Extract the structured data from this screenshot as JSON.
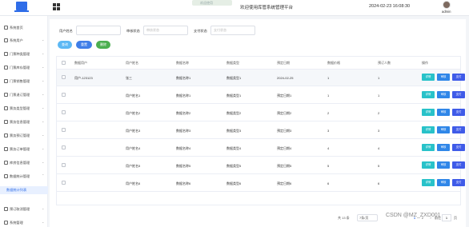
{
  "header": {
    "notice": "欢迎使用",
    "app_title": "欢迎使用库管系统管理平台",
    "datetime": "2024-02-23 16:08:30",
    "user": "admin"
  },
  "sidebar": {
    "items": [
      {
        "label": "系统首页"
      },
      {
        "label": "系统用户"
      },
      {
        "label": "门票种类管理"
      },
      {
        "label": "门票库存管理"
      },
      {
        "label": "门票销售管理"
      },
      {
        "label": "门票退订管理"
      },
      {
        "label": "票务类型管理"
      },
      {
        "label": "票务信息管理"
      },
      {
        "label": "票务预订管理"
      },
      {
        "label": "票务订单管理"
      },
      {
        "label": "库房信息管理"
      },
      {
        "label": "数据统计管理"
      },
      {
        "label": "数据统计列表"
      },
      {
        "label": "预订取消管理"
      },
      {
        "label": "系统管理"
      }
    ]
  },
  "search": {
    "fields": [
      {
        "label": "用户姓名",
        "placeholder": ""
      },
      {
        "label": "审核状态",
        "placeholder": "审核状态"
      },
      {
        "label": "支付状态",
        "placeholder": "支付状态"
      }
    ],
    "query_label": "查询",
    "reset_label": "重置",
    "delete_label": "删除"
  },
  "table": {
    "headers": [
      "数据用户",
      "用户姓名",
      "数据名称",
      "数据类型",
      "预定日期",
      "数据价格",
      "预订人数",
      "操作"
    ],
    "rows": [
      [
        "用户-123123",
        "张三",
        "数据名称1",
        "数据类型1",
        "2024-02-25",
        "1",
        "1"
      ],
      [
        "",
        "用户姓名1",
        "数据名称1",
        "数据类型1",
        "预定日期1",
        "1",
        "1"
      ],
      [
        "",
        "用户姓名2",
        "数据名称2",
        "数据类型2",
        "预定日期2",
        "2",
        "2"
      ],
      [
        "",
        "用户姓名3",
        "数据名称3",
        "数据类型3",
        "预定日期3",
        "3",
        "3"
      ],
      [
        "",
        "用户姓名4",
        "数据名称4",
        "数据类型4",
        "预定日期4",
        "4",
        "4"
      ],
      [
        "",
        "用户姓名5",
        "数据名称5",
        "数据类型5",
        "预定日期5",
        "5",
        "5"
      ],
      [
        "",
        "用户姓名6",
        "数据名称6",
        "数据类型6",
        "预定日期6",
        "6",
        "6"
      ]
    ],
    "actions": [
      "详情",
      "审核",
      "支付"
    ]
  },
  "pagination": {
    "total": "共 13 条",
    "page_size": "7条/页",
    "pages": [
      "1",
      "2"
    ],
    "current_page": "1",
    "goto_label": "前往",
    "goto_value": "1",
    "page_suffix": "页"
  },
  "watermark": "CSDN @MZ_ZXD001"
}
